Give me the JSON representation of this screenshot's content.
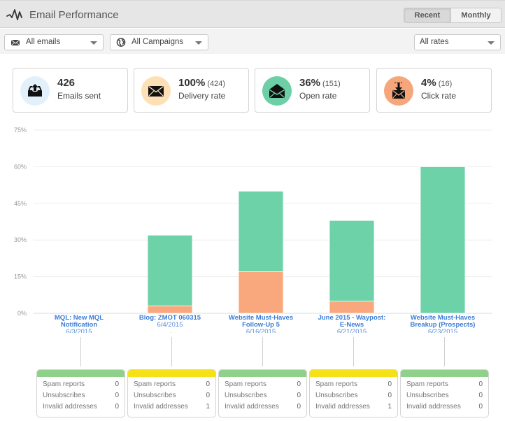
{
  "header": {
    "title": "Email Performance",
    "logo_icon": "pulse-icon",
    "view_toggle": [
      {
        "label": "Recent",
        "active": true
      },
      {
        "label": "Monthly",
        "active": false
      }
    ]
  },
  "filters": {
    "emails": {
      "icon": "envelope-icon",
      "value": "All emails"
    },
    "campaigns": {
      "icon": "globe-icon",
      "value": "All Campaigns"
    },
    "rates": {
      "value": "All rates"
    }
  },
  "kpis": [
    {
      "icon": "outbox-upload-icon",
      "value": "426",
      "sub": "",
      "label": "Emails sent",
      "color": "#e2f0fb"
    },
    {
      "icon": "envelope-closed-icon",
      "value": "100%",
      "sub": "(424)",
      "label": "Delivery rate",
      "color": "#fde0b6"
    },
    {
      "icon": "envelope-open-icon",
      "value": "36%",
      "sub": "(151)",
      "label": "Open rate",
      "color": "#6ccfa6"
    },
    {
      "icon": "envelope-download-icon",
      "value": "4%",
      "sub": "(16)",
      "label": "Click rate",
      "color": "#f7a67c"
    }
  ],
  "chart_data": {
    "type": "bar",
    "stacked": true,
    "title": "",
    "xlabel": "",
    "ylabel": "",
    "ylim": [
      0,
      75
    ],
    "yticks": [
      "0%",
      "15%",
      "30%",
      "45%",
      "60%",
      "75%"
    ],
    "ytick_values": [
      0,
      15,
      30,
      45,
      60,
      75
    ],
    "grid": true,
    "categories": [
      {
        "name": [
          "MQL: New MQL",
          "Notification"
        ],
        "date": "6/3/2015"
      },
      {
        "name": [
          "Blog: ZMOT 060315"
        ],
        "date": "6/4/2015"
      },
      {
        "name": [
          "Website Must-Haves",
          "Follow-Up 5"
        ],
        "date": "6/16/2015"
      },
      {
        "name": [
          "June 2015 - Waypost:",
          "E-News"
        ],
        "date": "6/21/2015"
      },
      {
        "name": [
          "Website Must-Haves",
          "Breakup (Prospects)"
        ],
        "date": "6/23/2015"
      }
    ],
    "series": [
      {
        "name": "Click rate",
        "color": "#f9a77c",
        "values": [
          0,
          3,
          17,
          5,
          0
        ]
      },
      {
        "name": "Open rate",
        "color": "#6ed2a8",
        "values": [
          0,
          29,
          33,
          33,
          60
        ]
      }
    ],
    "totals": [
      0,
      32,
      50,
      38,
      60
    ]
  },
  "stats": [
    {
      "status_color": "#8fd18b",
      "rows": [
        {
          "label": "Spam reports",
          "value": "0"
        },
        {
          "label": "Unsubscribes",
          "value": "0"
        },
        {
          "label": "Invalid addresses",
          "value": "0"
        }
      ]
    },
    {
      "status_color": "#f5e117",
      "rows": [
        {
          "label": "Spam reports",
          "value": "0"
        },
        {
          "label": "Unsubscribes",
          "value": "0"
        },
        {
          "label": "Invalid addresses",
          "value": "1"
        }
      ]
    },
    {
      "status_color": "#8fd18b",
      "rows": [
        {
          "label": "Spam reports",
          "value": "0"
        },
        {
          "label": "Unsubscribes",
          "value": "0"
        },
        {
          "label": "Invalid addresses",
          "value": "0"
        }
      ]
    },
    {
      "status_color": "#f5e117",
      "rows": [
        {
          "label": "Spam reports",
          "value": "0"
        },
        {
          "label": "Unsubscribes",
          "value": "0"
        },
        {
          "label": "Invalid addresses",
          "value": "1"
        }
      ]
    },
    {
      "status_color": "#8fd18b",
      "rows": [
        {
          "label": "Spam reports",
          "value": "0"
        },
        {
          "label": "Unsubscribes",
          "value": "0"
        },
        {
          "label": "Invalid addresses",
          "value": "0"
        }
      ]
    }
  ]
}
